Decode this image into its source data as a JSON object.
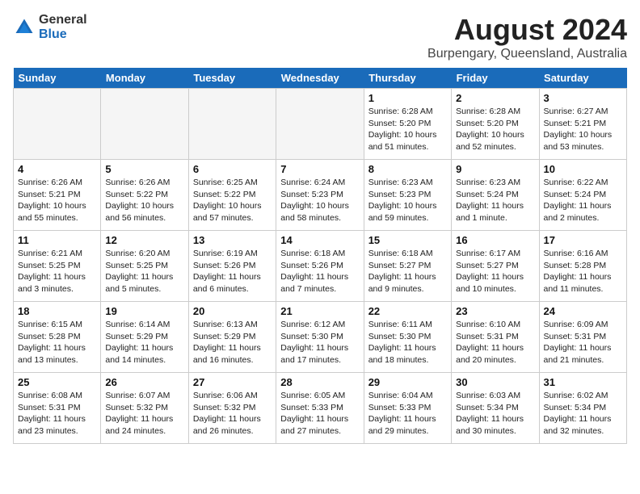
{
  "header": {
    "logo_general": "General",
    "logo_blue": "Blue",
    "month_year": "August 2024",
    "location": "Burpengary, Queensland, Australia"
  },
  "weekdays": [
    "Sunday",
    "Monday",
    "Tuesday",
    "Wednesday",
    "Thursday",
    "Friday",
    "Saturday"
  ],
  "weeks": [
    [
      {
        "day": "",
        "info": ""
      },
      {
        "day": "",
        "info": ""
      },
      {
        "day": "",
        "info": ""
      },
      {
        "day": "",
        "info": ""
      },
      {
        "day": "1",
        "info": "Sunrise: 6:28 AM\nSunset: 5:20 PM\nDaylight: 10 hours\nand 51 minutes."
      },
      {
        "day": "2",
        "info": "Sunrise: 6:28 AM\nSunset: 5:20 PM\nDaylight: 10 hours\nand 52 minutes."
      },
      {
        "day": "3",
        "info": "Sunrise: 6:27 AM\nSunset: 5:21 PM\nDaylight: 10 hours\nand 53 minutes."
      }
    ],
    [
      {
        "day": "4",
        "info": "Sunrise: 6:26 AM\nSunset: 5:21 PM\nDaylight: 10 hours\nand 55 minutes."
      },
      {
        "day": "5",
        "info": "Sunrise: 6:26 AM\nSunset: 5:22 PM\nDaylight: 10 hours\nand 56 minutes."
      },
      {
        "day": "6",
        "info": "Sunrise: 6:25 AM\nSunset: 5:22 PM\nDaylight: 10 hours\nand 57 minutes."
      },
      {
        "day": "7",
        "info": "Sunrise: 6:24 AM\nSunset: 5:23 PM\nDaylight: 10 hours\nand 58 minutes."
      },
      {
        "day": "8",
        "info": "Sunrise: 6:23 AM\nSunset: 5:23 PM\nDaylight: 10 hours\nand 59 minutes."
      },
      {
        "day": "9",
        "info": "Sunrise: 6:23 AM\nSunset: 5:24 PM\nDaylight: 11 hours\nand 1 minute."
      },
      {
        "day": "10",
        "info": "Sunrise: 6:22 AM\nSunset: 5:24 PM\nDaylight: 11 hours\nand 2 minutes."
      }
    ],
    [
      {
        "day": "11",
        "info": "Sunrise: 6:21 AM\nSunset: 5:25 PM\nDaylight: 11 hours\nand 3 minutes."
      },
      {
        "day": "12",
        "info": "Sunrise: 6:20 AM\nSunset: 5:25 PM\nDaylight: 11 hours\nand 5 minutes."
      },
      {
        "day": "13",
        "info": "Sunrise: 6:19 AM\nSunset: 5:26 PM\nDaylight: 11 hours\nand 6 minutes."
      },
      {
        "day": "14",
        "info": "Sunrise: 6:18 AM\nSunset: 5:26 PM\nDaylight: 11 hours\nand 7 minutes."
      },
      {
        "day": "15",
        "info": "Sunrise: 6:18 AM\nSunset: 5:27 PM\nDaylight: 11 hours\nand 9 minutes."
      },
      {
        "day": "16",
        "info": "Sunrise: 6:17 AM\nSunset: 5:27 PM\nDaylight: 11 hours\nand 10 minutes."
      },
      {
        "day": "17",
        "info": "Sunrise: 6:16 AM\nSunset: 5:28 PM\nDaylight: 11 hours\nand 11 minutes."
      }
    ],
    [
      {
        "day": "18",
        "info": "Sunrise: 6:15 AM\nSunset: 5:28 PM\nDaylight: 11 hours\nand 13 minutes."
      },
      {
        "day": "19",
        "info": "Sunrise: 6:14 AM\nSunset: 5:29 PM\nDaylight: 11 hours\nand 14 minutes."
      },
      {
        "day": "20",
        "info": "Sunrise: 6:13 AM\nSunset: 5:29 PM\nDaylight: 11 hours\nand 16 minutes."
      },
      {
        "day": "21",
        "info": "Sunrise: 6:12 AM\nSunset: 5:30 PM\nDaylight: 11 hours\nand 17 minutes."
      },
      {
        "day": "22",
        "info": "Sunrise: 6:11 AM\nSunset: 5:30 PM\nDaylight: 11 hours\nand 18 minutes."
      },
      {
        "day": "23",
        "info": "Sunrise: 6:10 AM\nSunset: 5:31 PM\nDaylight: 11 hours\nand 20 minutes."
      },
      {
        "day": "24",
        "info": "Sunrise: 6:09 AM\nSunset: 5:31 PM\nDaylight: 11 hours\nand 21 minutes."
      }
    ],
    [
      {
        "day": "25",
        "info": "Sunrise: 6:08 AM\nSunset: 5:31 PM\nDaylight: 11 hours\nand 23 minutes."
      },
      {
        "day": "26",
        "info": "Sunrise: 6:07 AM\nSunset: 5:32 PM\nDaylight: 11 hours\nand 24 minutes."
      },
      {
        "day": "27",
        "info": "Sunrise: 6:06 AM\nSunset: 5:32 PM\nDaylight: 11 hours\nand 26 minutes."
      },
      {
        "day": "28",
        "info": "Sunrise: 6:05 AM\nSunset: 5:33 PM\nDaylight: 11 hours\nand 27 minutes."
      },
      {
        "day": "29",
        "info": "Sunrise: 6:04 AM\nSunset: 5:33 PM\nDaylight: 11 hours\nand 29 minutes."
      },
      {
        "day": "30",
        "info": "Sunrise: 6:03 AM\nSunset: 5:34 PM\nDaylight: 11 hours\nand 30 minutes."
      },
      {
        "day": "31",
        "info": "Sunrise: 6:02 AM\nSunset: 5:34 PM\nDaylight: 11 hours\nand 32 minutes."
      }
    ]
  ]
}
